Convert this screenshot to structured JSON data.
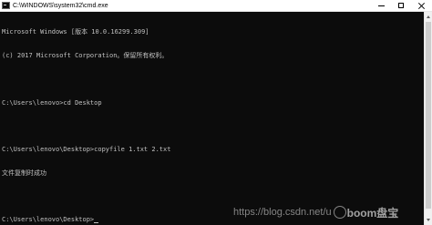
{
  "window": {
    "title": "C:\\WINDOWS\\system32\\cmd.exe"
  },
  "console": {
    "lines": [
      "Microsoft Windows [版本 10.0.16299.309]",
      "(c) 2017 Microsoft Corporation。保留所有权利。",
      "",
      "C:\\Users\\lenovo>cd Desktop",
      "",
      "C:\\Users\\lenovo\\Desktop>copyfile 1.txt 2.txt",
      "文件复制时成功",
      "",
      "C:\\Users\\lenovo\\Desktop>"
    ]
  },
  "watermark": {
    "url": "https://blog.csdn.net/u",
    "handle": "boom盘宝"
  },
  "icons": {
    "app": "cmd-icon",
    "minimize": "minimize-icon",
    "maximize": "maximize-icon",
    "close": "close-icon"
  },
  "colors": {
    "console_background": "#0c0c0c",
    "console_text": "#c0c0c0",
    "titlebar_background": "#ffffff"
  }
}
